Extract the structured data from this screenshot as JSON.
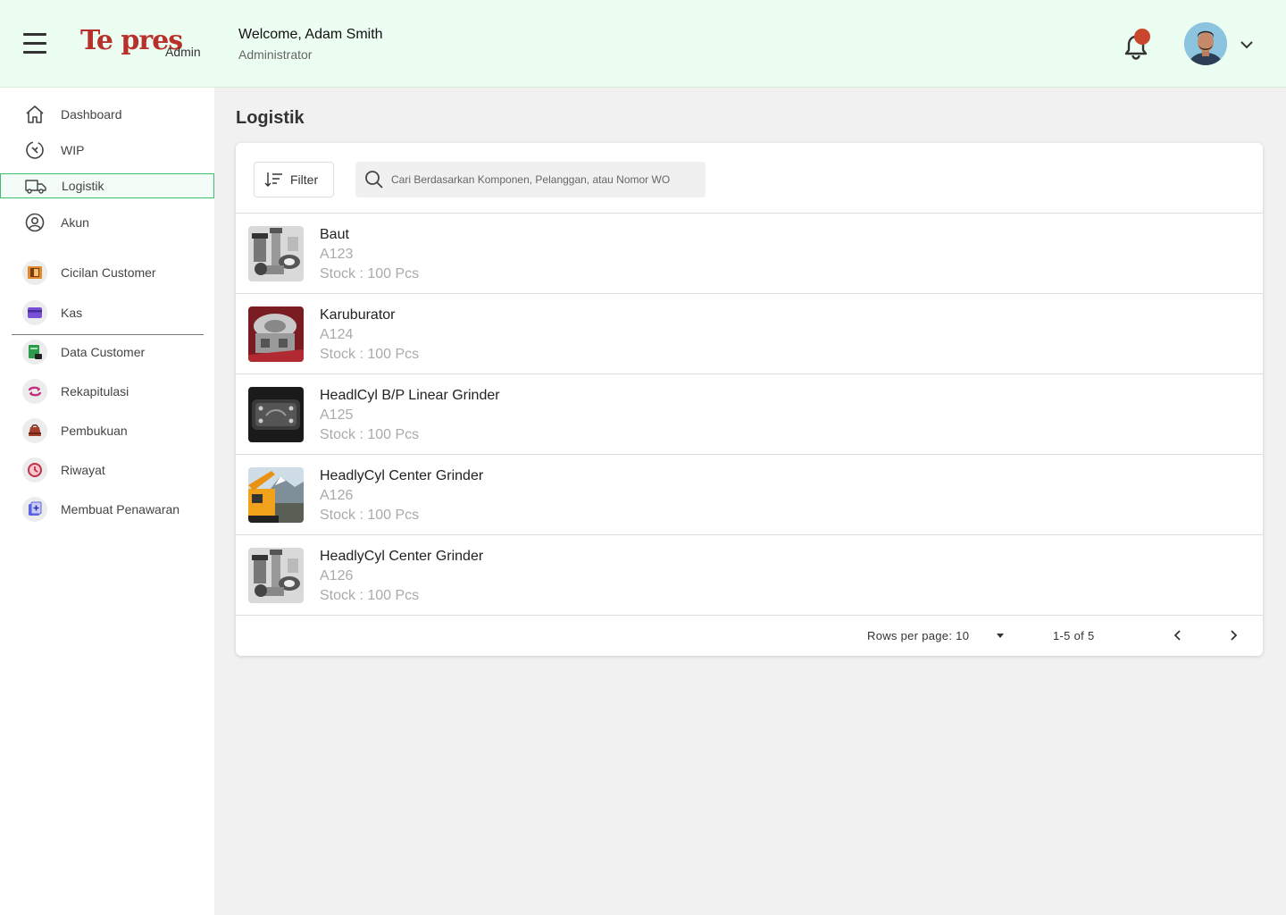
{
  "header": {
    "logo_text": "Te pres",
    "logo_sub": "Admin",
    "welcome": "Welcome, Adam Smith",
    "role": "Administrator"
  },
  "sidebar": {
    "main_items": [
      {
        "label": "Dashboard",
        "icon": "home-icon"
      },
      {
        "label": "WIP",
        "icon": "wip-icon"
      },
      {
        "label": "Logistik",
        "icon": "truck-icon",
        "active": true
      },
      {
        "label": "Akun",
        "icon": "account-icon"
      }
    ],
    "secondary_items": [
      {
        "label": "Cicilan Customer",
        "icon": "installment-icon"
      },
      {
        "label": "Kas",
        "icon": "wallet-icon"
      },
      {
        "label": "Data Customer",
        "icon": "customer-data-icon"
      },
      {
        "label": "Rekapitulasi",
        "icon": "recap-icon"
      },
      {
        "label": "Pembukuan",
        "icon": "bookkeeping-icon"
      },
      {
        "label": "Riwayat",
        "icon": "history-icon"
      },
      {
        "label": "Membuat Penawaran",
        "icon": "create-offer-icon"
      }
    ]
  },
  "main": {
    "title": "Logistik",
    "filter_label": "Filter",
    "search_placeholder": "Cari Berdasarkan Komponen, Pelanggan, atau Nomor WO",
    "items": [
      {
        "name": "Baut",
        "code": "A123",
        "stock": "Stock : 100 Pcs"
      },
      {
        "name": "Karuburator",
        "code": "A124",
        "stock": "Stock : 100 Pcs"
      },
      {
        "name": "HeadlCyl B/P Linear Grinder",
        "code": "A125",
        "stock": "Stock : 100 Pcs"
      },
      {
        "name": "HeadlyCyl Center Grinder",
        "code": "A126",
        "stock": "Stock : 100 Pcs"
      },
      {
        "name": "HeadlyCyl Center Grinder",
        "code": "A126",
        "stock": "Stock : 100 Pcs"
      }
    ],
    "pagination": {
      "rows_per_page": "Rows per page: 10",
      "range": "1-5 of 5"
    }
  },
  "colors": {
    "accent": "#3bbf70",
    "brand": "#b8302b",
    "header_bg": "#ecfdf1",
    "notification": "#c9472c"
  }
}
